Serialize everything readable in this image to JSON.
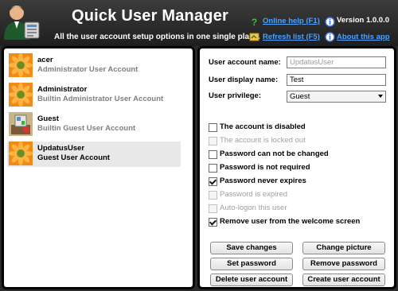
{
  "header": {
    "title": "Quick User Manager",
    "subtitle": "All the user account setup options in one single place.",
    "online_help": "Online help (F1)",
    "refresh_list": "Refresh list (F5)",
    "version": "Version 1.0.0.0",
    "about": "About this app"
  },
  "users": [
    {
      "name": "acer",
      "description": "Administrator User Account",
      "avatar": "flower-avatar"
    },
    {
      "name": "Administrator",
      "description": "Builtin Administrator User Account",
      "avatar": "flower-avatar"
    },
    {
      "name": "Guest",
      "description": "Builtin Guest User Account",
      "avatar": "guest-avatar"
    },
    {
      "name": "UpdatusUser",
      "description": "Guest User Account",
      "avatar": "flower-avatar",
      "selected": true
    }
  ],
  "form": {
    "account_name_label": "User account name:",
    "account_name_value": "UpdatusUser",
    "display_name_label": "User display name:",
    "display_name_value": "Test",
    "privilege_label": "User privilege:",
    "privilege_value": "Guest"
  },
  "options": [
    {
      "label": "The account is disabled",
      "checked": false,
      "enabled": true
    },
    {
      "label": "The account is locked out",
      "checked": false,
      "enabled": false
    },
    {
      "label": "Password can not be changed",
      "checked": false,
      "enabled": true
    },
    {
      "label": "Password is not required",
      "checked": false,
      "enabled": true
    },
    {
      "label": "Password never expires",
      "checked": true,
      "enabled": true
    },
    {
      "label": "Password is expired",
      "checked": false,
      "enabled": false
    },
    {
      "label": "Auto-logon this user",
      "checked": false,
      "enabled": false
    },
    {
      "label": "Remove user from the welcome screen",
      "checked": true,
      "enabled": true
    }
  ],
  "buttons": {
    "save_changes": "Save changes",
    "change_picture": "Change picture",
    "set_password": "Set password",
    "remove_password": "Remove password",
    "delete_user": "Delete user account",
    "create_user": "Create user account"
  },
  "colors": {
    "header_bg": "#2a2a2a",
    "link": "#4da3ff",
    "panel_border": "#000000",
    "selected_row": "#e8e8e8"
  }
}
